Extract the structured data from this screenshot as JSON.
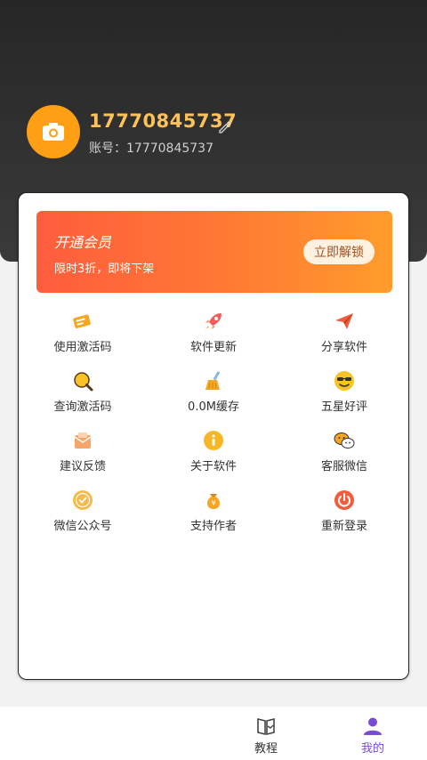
{
  "profile": {
    "username": "17770845737",
    "account_label": "账号：17770845737"
  },
  "vip": {
    "title": "开通会员",
    "subtitle": "限时3折，即将下架",
    "button_label": "立即解锁"
  },
  "menu": {
    "items": [
      {
        "label": "使用激活码",
        "icon": "ticket-icon"
      },
      {
        "label": "软件更新",
        "icon": "rocket-icon"
      },
      {
        "label": "分享软件",
        "icon": "paper-plane-icon"
      },
      {
        "label": "查询激活码",
        "icon": "magnifier-icon"
      },
      {
        "label": "0.0M缓存",
        "icon": "broom-icon"
      },
      {
        "label": "五星好评",
        "icon": "sunglasses-face-icon"
      },
      {
        "label": "建议反馈",
        "icon": "mail-icon"
      },
      {
        "label": "关于软件",
        "icon": "info-icon"
      },
      {
        "label": "客服微信",
        "icon": "wechat-icon"
      },
      {
        "label": "微信公众号",
        "icon": "badge-check-icon"
      },
      {
        "label": "支持作者",
        "icon": "money-bag-icon"
      },
      {
        "label": "重新登录",
        "icon": "power-icon"
      }
    ]
  },
  "bottom_nav": {
    "tabs": [
      {
        "label": "教程",
        "icon": "book-icon",
        "active": false
      },
      {
        "label": "我的",
        "icon": "person-icon",
        "active": true
      }
    ]
  },
  "colors": {
    "accent_orange": "#ff9f13",
    "username_gold": "#ffc25a",
    "active_tab": "#7a4cd6"
  }
}
